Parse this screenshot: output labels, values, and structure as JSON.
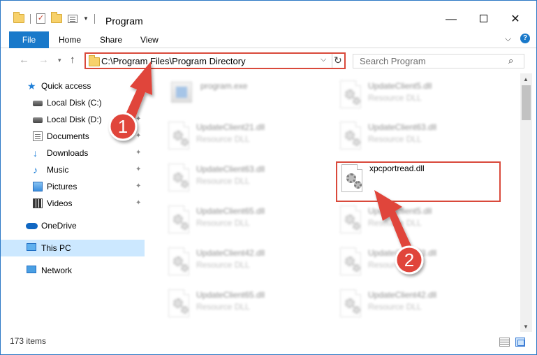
{
  "window": {
    "title": "Program",
    "controls": {
      "minimize": "—",
      "maximize": "",
      "close": "✕"
    }
  },
  "ribbon": {
    "tabs": {
      "file": "File",
      "home": "Home",
      "share": "Share",
      "view": "View"
    },
    "expand_icon": "chevron-down-icon",
    "help_glyph": "?"
  },
  "navigation": {
    "back_glyph": "←",
    "forward_glyph": "→",
    "recent_glyph": "▾",
    "up_glyph": "↑",
    "address": "C:\\Program Files\\Program Directory",
    "address_dropdown_glyph": "⌵",
    "refresh_glyph": "↻",
    "search_placeholder": "Search Program",
    "search_glyph": "⌕"
  },
  "sidebar": {
    "items": [
      {
        "label": "Quick access",
        "icon": "star-icon",
        "pinned": false
      },
      {
        "label": "Local Disk (C:)",
        "icon": "drive-icon",
        "pinned": true
      },
      {
        "label": "Local Disk (D:)",
        "icon": "drive-icon",
        "pinned": true
      },
      {
        "label": "Documents",
        "icon": "documents-icon",
        "pinned": true
      },
      {
        "label": "Downloads",
        "icon": "download-icon",
        "pinned": true
      },
      {
        "label": "Music",
        "icon": "music-icon",
        "pinned": true
      },
      {
        "label": "Pictures",
        "icon": "pictures-icon",
        "pinned": true
      },
      {
        "label": "Videos",
        "icon": "videos-icon",
        "pinned": true
      },
      {
        "label": "OneDrive",
        "icon": "onedrive-icon",
        "pinned": false
      },
      {
        "label": "This PC",
        "icon": "pc-icon",
        "pinned": false,
        "selected": true
      },
      {
        "label": "Network",
        "icon": "network-icon",
        "pinned": false
      }
    ],
    "pin_glyph": "📌"
  },
  "files": [
    {
      "name": "program.exe",
      "type": "",
      "icon": "exe-icon"
    },
    {
      "name": "UpdateClient5.dll",
      "type": "Resource DLL",
      "icon": "dll-icon"
    },
    {
      "name": "UpdateClient21.dll",
      "type": "Resource DLL",
      "icon": "dll-icon"
    },
    {
      "name": "UpdateClient63.dll",
      "type": "Resource DLL",
      "icon": "dll-icon"
    },
    {
      "name": "UpdateClient63.dll",
      "type": "Resource DLL",
      "icon": "dll-icon"
    },
    {
      "name": "xpcportread.dll",
      "type": "",
      "icon": "dll-icon",
      "highlighted": true
    },
    {
      "name": "UpdateClient65.dll",
      "type": "Resource DLL",
      "icon": "dll-icon"
    },
    {
      "name": "UpdateClient5.dll",
      "type": "Resource DLL",
      "icon": "dll-icon"
    },
    {
      "name": "UpdateClient42.dll",
      "type": "Resource DLL",
      "icon": "dll-icon"
    },
    {
      "name": "UpdateClient63.dll",
      "type": "Resource DLL",
      "icon": "dll-icon"
    },
    {
      "name": "UpdateClient65.dll",
      "type": "Resource DLL",
      "icon": "dll-icon"
    },
    {
      "name": "UpdateClient42.dll",
      "type": "Resource DLL",
      "icon": "dll-icon"
    }
  ],
  "status": {
    "item_count": "173 items"
  },
  "annotations": [
    {
      "number": "1",
      "color": "#e0443a"
    },
    {
      "number": "2",
      "color": "#e0443a"
    }
  ],
  "colors": {
    "accent": "#1979ca",
    "highlight_border": "#d9493b",
    "selected_nav": "#cce8ff"
  }
}
